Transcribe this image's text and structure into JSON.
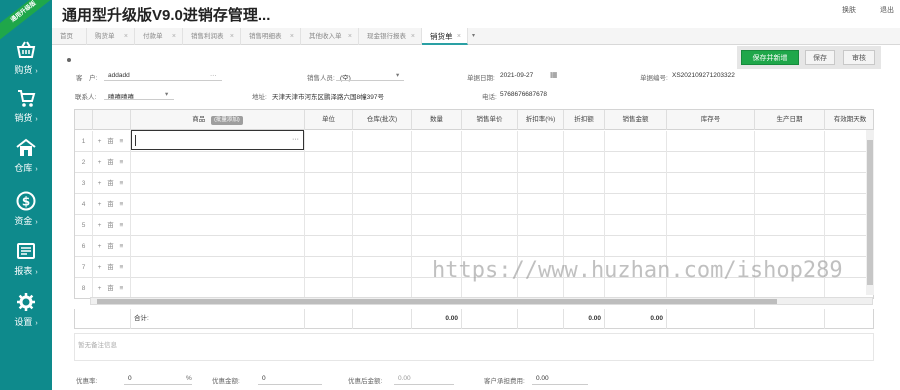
{
  "brand": {
    "badge_text": "通用升级版",
    "app_title": "通用型升级版V9.0进销存管理..."
  },
  "top_links": {
    "left": "换肤",
    "right": "退出"
  },
  "sidebar": {
    "items": [
      {
        "label": "购货",
        "icon": "basket-icon"
      },
      {
        "label": "销货",
        "icon": "cart-icon"
      },
      {
        "label": "仓库",
        "icon": "warehouse-icon"
      },
      {
        "label": "资金",
        "icon": "money-icon"
      },
      {
        "label": "报表",
        "icon": "report-icon"
      },
      {
        "label": "设置",
        "icon": "gear-icon"
      }
    ]
  },
  "tabs": [
    {
      "label": "首页"
    },
    {
      "label": "购货单"
    },
    {
      "label": "付款单"
    },
    {
      "label": "销售利润表"
    },
    {
      "label": "销售明细表"
    },
    {
      "label": "其他收入单"
    },
    {
      "label": "现金银行报表"
    },
    {
      "label": "销货单"
    }
  ],
  "toolbar": {
    "save_new": "保存并新增",
    "save": "保存",
    "audit": "审核"
  },
  "form": {
    "customer_label": "客　户:",
    "customer_value": "addadd",
    "customer_more": "···",
    "sales_label": "销售人员:",
    "sales_value": "(空)",
    "date_label": "单据日期:",
    "date_value": "2021-09-27",
    "bill_label": "单据编号:",
    "bill_value": "XS202109271203322",
    "contact_label": "联系人:",
    "contact_value": "嘻嘻嘻嘻",
    "address_label": "地址:",
    "address_value": "天津天津市河东区鹏泽路六国8幢397号",
    "phone_label": "电话:",
    "phone_value": "5768676687678"
  },
  "grid": {
    "headers": [
      "商品",
      "单位",
      "仓库(批次)",
      "数量",
      "销售单价",
      "折扣率(%)",
      "折扣额",
      "销售金额",
      "库存号",
      "生产日期",
      "有效期天数"
    ],
    "product_tag": "(批量添加)",
    "rows": [
      "1",
      "2",
      "3",
      "4",
      "5",
      "6",
      "7",
      "8"
    ],
    "row_actions": "+ 亩 ≡"
  },
  "totals": {
    "label": "合计:",
    "qty": "0.00",
    "discount": "0.00",
    "amount": "0.00"
  },
  "remark_placeholder": "暂无备注信息",
  "watermark": "https://www.huzhan.com/ishop289",
  "footer": {
    "discount_rate_label": "优惠率:",
    "discount_rate_value": "0",
    "percent": "%",
    "discount_amount_label": "优惠金额:",
    "discount_amount_value": "0",
    "after_discount_label": "优惠后金额:",
    "after_discount_value": "0.00",
    "customer_fee_label": "客户承担费用:",
    "customer_fee_value": "0.00"
  },
  "colors": {
    "sidebar": "#0e8a8c",
    "primary_button": "#1fa74a",
    "active_tab_line": "#2aa0a4"
  }
}
